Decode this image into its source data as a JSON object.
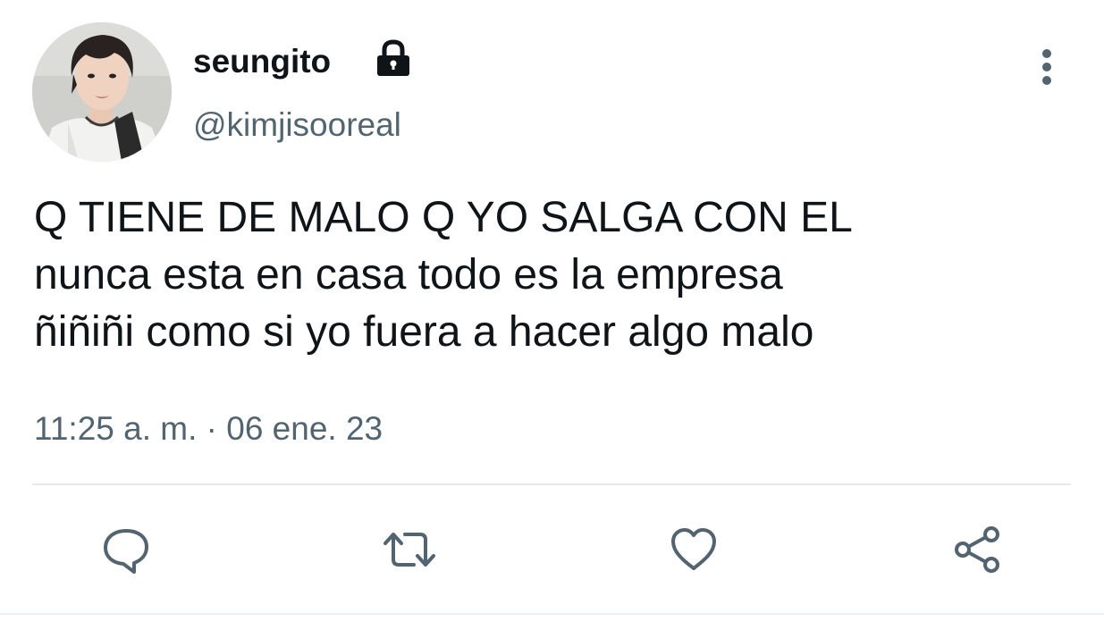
{
  "tweet": {
    "display_name": "seungito",
    "handle": "@kimjisooreal",
    "text_lines": [
      "Q TIENE DE MALO Q YO SALGA CON EL",
      "nunca esta en casa todo es la empresa",
      "ñiñiñi como si yo fuera a hacer algo malo"
    ],
    "timestamp": "11:25 a. m. · 06 ene. 23"
  },
  "icons": {
    "lock": "lock-icon",
    "more": "more-vertical-icon",
    "reply": "reply-icon",
    "retweet": "retweet-icon",
    "like": "heart-icon",
    "share": "share-icon"
  },
  "colors": {
    "text": "#0f1419",
    "secondary": "#536471",
    "divider": "#e6e9eb"
  }
}
